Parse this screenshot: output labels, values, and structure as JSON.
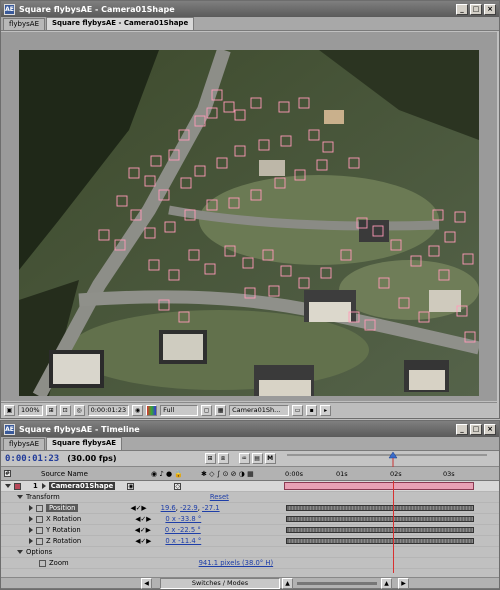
{
  "comp_window": {
    "title": "Square flybysAE - Camera01Shape",
    "tabs": [
      "flybysAE",
      "Square flybysAE - Camera01Shape"
    ],
    "zoom": "100%",
    "timecode": "0:00:01:23",
    "resolution": "Full",
    "camera": "Camera01Sh..."
  },
  "timeline_window": {
    "title": "Square flybysAE - Timeline",
    "tabs": [
      "flybysAE",
      "Square flybysAE"
    ],
    "timecode": "0:00:01:23",
    "fps": "(30.00 fps)",
    "ruler": [
      "0:00s",
      "01s",
      "02s",
      "03s"
    ],
    "source_name_header": "Source Name",
    "layer_number": "1",
    "layer_name": "Camera01Shape",
    "transform_label": "Transform",
    "reset_label": "Reset",
    "properties": [
      {
        "name": "Position",
        "values": [
          "19.6",
          "-22.9",
          "-27.1"
        ]
      },
      {
        "name": "X Rotation",
        "values": [
          "0 x -33.8 °"
        ]
      },
      {
        "name": "Y Rotation",
        "values": [
          "0 x -22.5 °"
        ]
      },
      {
        "name": "Z Rotation",
        "values": [
          "0 x -11.4 °"
        ]
      }
    ],
    "options_label": "Options",
    "zoom_label": "Zoom",
    "zoom_value": "941.1 pixels (38.0° H)",
    "switches_label": "Switches / Modes"
  },
  "colors": {
    "title_bar": "#6b6b6b",
    "timecode_blue": "#223c9a",
    "tracker_pink": "#ff9ab8",
    "layer_bar": "#e8a0b4"
  }
}
